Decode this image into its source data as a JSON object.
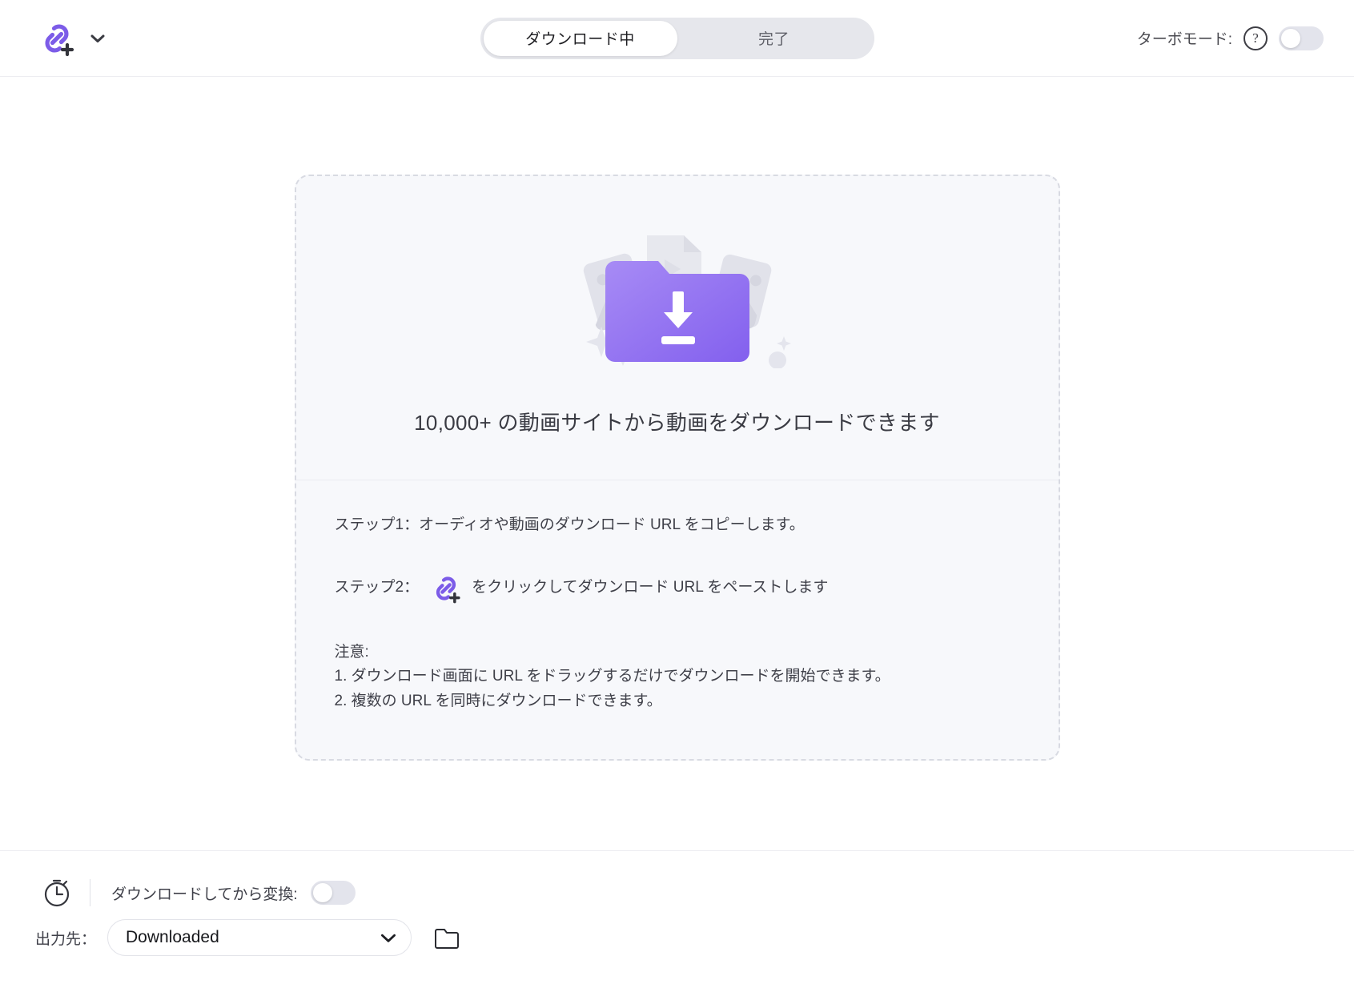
{
  "header": {
    "logo_icon": "link-plus-icon",
    "dropdown_icon": "chevron-down-icon",
    "tabs": [
      {
        "label": "ダウンロード中",
        "active": true
      },
      {
        "label": "完了",
        "active": false
      }
    ],
    "turbo": {
      "label": "ターボモード:",
      "help_icon": "question-mark-icon",
      "toggle_state": "off"
    }
  },
  "main": {
    "illustration_icon": "download-folder-illustration",
    "headline": "10,000+ の動画サイトから動画をダウンロードできます",
    "steps": [
      {
        "prefix": "ステップ1：オーディオや動画のダウンロード URL をコピーします。",
        "icon": "",
        "suffix": ""
      },
      {
        "prefix": "ステップ2：",
        "icon": "link-plus-icon",
        "suffix": "をクリックしてダウンロード URL をペーストします"
      }
    ],
    "notes_title": "注意:",
    "notes": [
      "1. ダウンロード画面に URL をドラッグするだけでダウンロードを開始できます。",
      "2. 複数の URL を同時にダウンロードできます。"
    ]
  },
  "footer": {
    "timer_icon": "stopwatch-icon",
    "convert_label": "ダウンロードしてから変換:",
    "convert_toggle_state": "off",
    "output_label": "出力先：",
    "output_value": "Downloaded",
    "output_dropdown_icon": "chevron-down-icon",
    "browse_icon": "folder-icon"
  },
  "colors": {
    "accent_purple": "#7c5ce8",
    "accent_purple_light": "#a78bf5",
    "tab_track": "#e6e7ec",
    "card_bg": "#f7f8fb",
    "card_border": "#d8dae2",
    "text_primary": "#3f4049",
    "text_muted": "#5f6068"
  }
}
